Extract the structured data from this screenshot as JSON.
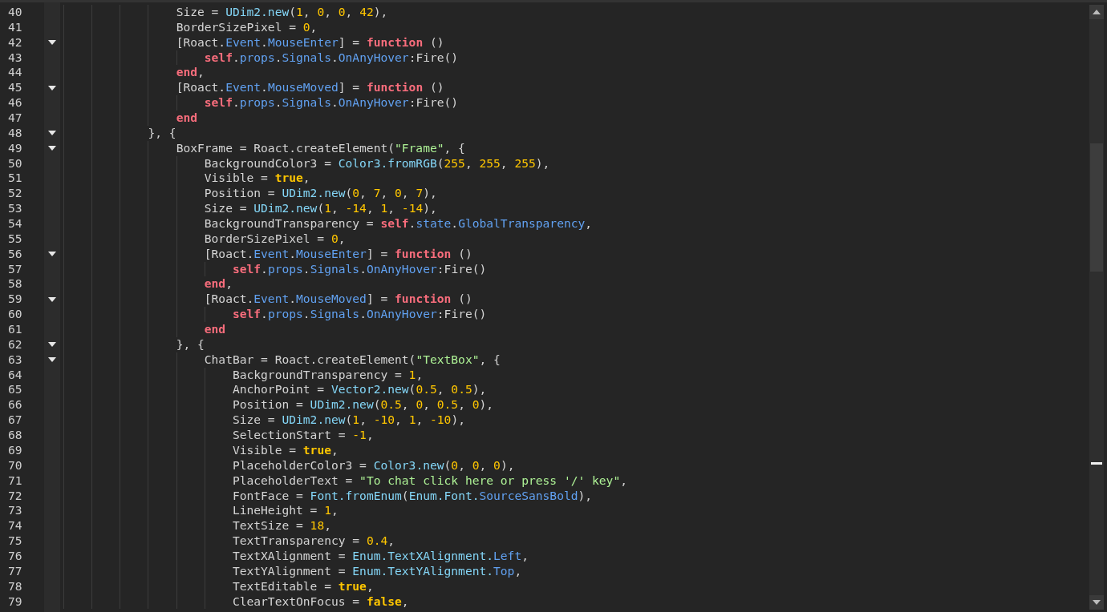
{
  "editor": {
    "lines": [
      {
        "number": "40",
        "fold": false,
        "tokens": [
          {
            "kind": "plain",
            "text": "                Size = "
          },
          {
            "kind": "builtin",
            "text": "UDim2.new"
          },
          {
            "kind": "plain",
            "text": "("
          },
          {
            "kind": "number",
            "text": "1"
          },
          {
            "kind": "plain",
            "text": ", "
          },
          {
            "kind": "number",
            "text": "0"
          },
          {
            "kind": "plain",
            "text": ", "
          },
          {
            "kind": "number",
            "text": "0"
          },
          {
            "kind": "plain",
            "text": ", "
          },
          {
            "kind": "number",
            "text": "42"
          },
          {
            "kind": "plain",
            "text": "),"
          }
        ]
      },
      {
        "number": "41",
        "fold": false,
        "tokens": [
          {
            "kind": "plain",
            "text": "                BorderSizePixel = "
          },
          {
            "kind": "number",
            "text": "0"
          },
          {
            "kind": "plain",
            "text": ","
          }
        ]
      },
      {
        "number": "42",
        "fold": true,
        "tokens": [
          {
            "kind": "plain",
            "text": "                [Roact."
          },
          {
            "kind": "member",
            "text": "Event"
          },
          {
            "kind": "plain",
            "text": "."
          },
          {
            "kind": "member",
            "text": "MouseEnter"
          },
          {
            "kind": "plain",
            "text": "] = "
          },
          {
            "kind": "keyword",
            "text": "function"
          },
          {
            "kind": "plain",
            "text": " ()"
          }
        ]
      },
      {
        "number": "43",
        "fold": false,
        "tokens": [
          {
            "kind": "keyword",
            "text": "                    self"
          },
          {
            "kind": "plain",
            "text": "."
          },
          {
            "kind": "member",
            "text": "props"
          },
          {
            "kind": "plain",
            "text": "."
          },
          {
            "kind": "member",
            "text": "Signals"
          },
          {
            "kind": "plain",
            "text": "."
          },
          {
            "kind": "member",
            "text": "OnAnyHover"
          },
          {
            "kind": "plain",
            "text": ":Fire()"
          }
        ]
      },
      {
        "number": "44",
        "fold": false,
        "tokens": [
          {
            "kind": "keyword",
            "text": "                end"
          },
          {
            "kind": "plain",
            "text": ","
          }
        ]
      },
      {
        "number": "45",
        "fold": true,
        "tokens": [
          {
            "kind": "plain",
            "text": "                [Roact."
          },
          {
            "kind": "member",
            "text": "Event"
          },
          {
            "kind": "plain",
            "text": "."
          },
          {
            "kind": "member",
            "text": "MouseMoved"
          },
          {
            "kind": "plain",
            "text": "] = "
          },
          {
            "kind": "keyword",
            "text": "function"
          },
          {
            "kind": "plain",
            "text": " ()"
          }
        ]
      },
      {
        "number": "46",
        "fold": false,
        "tokens": [
          {
            "kind": "keyword",
            "text": "                    self"
          },
          {
            "kind": "plain",
            "text": "."
          },
          {
            "kind": "member",
            "text": "props"
          },
          {
            "kind": "plain",
            "text": "."
          },
          {
            "kind": "member",
            "text": "Signals"
          },
          {
            "kind": "plain",
            "text": "."
          },
          {
            "kind": "member",
            "text": "OnAnyHover"
          },
          {
            "kind": "plain",
            "text": ":Fire()"
          }
        ]
      },
      {
        "number": "47",
        "fold": false,
        "tokens": [
          {
            "kind": "keyword",
            "text": "                end"
          }
        ]
      },
      {
        "number": "48",
        "fold": true,
        "tokens": [
          {
            "kind": "plain",
            "text": "            }, {"
          }
        ]
      },
      {
        "number": "49",
        "fold": true,
        "tokens": [
          {
            "kind": "plain",
            "text": "                BoxFrame = Roact.createElement("
          },
          {
            "kind": "string",
            "text": "\"Frame\""
          },
          {
            "kind": "plain",
            "text": ", {"
          }
        ]
      },
      {
        "number": "50",
        "fold": false,
        "tokens": [
          {
            "kind": "plain",
            "text": "                    BackgroundColor3 = "
          },
          {
            "kind": "builtin",
            "text": "Color3.fromRGB"
          },
          {
            "kind": "plain",
            "text": "("
          },
          {
            "kind": "number",
            "text": "255"
          },
          {
            "kind": "plain",
            "text": ", "
          },
          {
            "kind": "number",
            "text": "255"
          },
          {
            "kind": "plain",
            "text": ", "
          },
          {
            "kind": "number",
            "text": "255"
          },
          {
            "kind": "plain",
            "text": "),"
          }
        ]
      },
      {
        "number": "51",
        "fold": false,
        "tokens": [
          {
            "kind": "plain",
            "text": "                    Visible = "
          },
          {
            "kind": "boolean",
            "text": "true"
          },
          {
            "kind": "plain",
            "text": ","
          }
        ]
      },
      {
        "number": "52",
        "fold": false,
        "tokens": [
          {
            "kind": "plain",
            "text": "                    Position = "
          },
          {
            "kind": "builtin",
            "text": "UDim2.new"
          },
          {
            "kind": "plain",
            "text": "("
          },
          {
            "kind": "number",
            "text": "0"
          },
          {
            "kind": "plain",
            "text": ", "
          },
          {
            "kind": "number",
            "text": "7"
          },
          {
            "kind": "plain",
            "text": ", "
          },
          {
            "kind": "number",
            "text": "0"
          },
          {
            "kind": "plain",
            "text": ", "
          },
          {
            "kind": "number",
            "text": "7"
          },
          {
            "kind": "plain",
            "text": "),"
          }
        ]
      },
      {
        "number": "53",
        "fold": false,
        "tokens": [
          {
            "kind": "plain",
            "text": "                    Size = "
          },
          {
            "kind": "builtin",
            "text": "UDim2.new"
          },
          {
            "kind": "plain",
            "text": "("
          },
          {
            "kind": "number",
            "text": "1"
          },
          {
            "kind": "plain",
            "text": ", "
          },
          {
            "kind": "number",
            "text": "-14"
          },
          {
            "kind": "plain",
            "text": ", "
          },
          {
            "kind": "number",
            "text": "1"
          },
          {
            "kind": "plain",
            "text": ", "
          },
          {
            "kind": "number",
            "text": "-14"
          },
          {
            "kind": "plain",
            "text": "),"
          }
        ]
      },
      {
        "number": "54",
        "fold": false,
        "tokens": [
          {
            "kind": "plain",
            "text": "                    BackgroundTransparency = "
          },
          {
            "kind": "keyword",
            "text": "self"
          },
          {
            "kind": "plain",
            "text": "."
          },
          {
            "kind": "member",
            "text": "state"
          },
          {
            "kind": "plain",
            "text": "."
          },
          {
            "kind": "member",
            "text": "GlobalTransparency"
          },
          {
            "kind": "plain",
            "text": ","
          }
        ]
      },
      {
        "number": "55",
        "fold": false,
        "tokens": [
          {
            "kind": "plain",
            "text": "                    BorderSizePixel = "
          },
          {
            "kind": "number",
            "text": "0"
          },
          {
            "kind": "plain",
            "text": ","
          }
        ]
      },
      {
        "number": "56",
        "fold": true,
        "tokens": [
          {
            "kind": "plain",
            "text": "                    [Roact."
          },
          {
            "kind": "member",
            "text": "Event"
          },
          {
            "kind": "plain",
            "text": "."
          },
          {
            "kind": "member",
            "text": "MouseEnter"
          },
          {
            "kind": "plain",
            "text": "] = "
          },
          {
            "kind": "keyword",
            "text": "function"
          },
          {
            "kind": "plain",
            "text": " ()"
          }
        ]
      },
      {
        "number": "57",
        "fold": false,
        "tokens": [
          {
            "kind": "keyword",
            "text": "                        self"
          },
          {
            "kind": "plain",
            "text": "."
          },
          {
            "kind": "member",
            "text": "props"
          },
          {
            "kind": "plain",
            "text": "."
          },
          {
            "kind": "member",
            "text": "Signals"
          },
          {
            "kind": "plain",
            "text": "."
          },
          {
            "kind": "member",
            "text": "OnAnyHover"
          },
          {
            "kind": "plain",
            "text": ":Fire()"
          }
        ]
      },
      {
        "number": "58",
        "fold": false,
        "tokens": [
          {
            "kind": "keyword",
            "text": "                    end"
          },
          {
            "kind": "plain",
            "text": ","
          }
        ]
      },
      {
        "number": "59",
        "fold": true,
        "tokens": [
          {
            "kind": "plain",
            "text": "                    [Roact."
          },
          {
            "kind": "member",
            "text": "Event"
          },
          {
            "kind": "plain",
            "text": "."
          },
          {
            "kind": "member",
            "text": "MouseMoved"
          },
          {
            "kind": "plain",
            "text": "] = "
          },
          {
            "kind": "keyword",
            "text": "function"
          },
          {
            "kind": "plain",
            "text": " ()"
          }
        ]
      },
      {
        "number": "60",
        "fold": false,
        "tokens": [
          {
            "kind": "keyword",
            "text": "                        self"
          },
          {
            "kind": "plain",
            "text": "."
          },
          {
            "kind": "member",
            "text": "props"
          },
          {
            "kind": "plain",
            "text": "."
          },
          {
            "kind": "member",
            "text": "Signals"
          },
          {
            "kind": "plain",
            "text": "."
          },
          {
            "kind": "member",
            "text": "OnAnyHover"
          },
          {
            "kind": "plain",
            "text": ":Fire()"
          }
        ]
      },
      {
        "number": "61",
        "fold": false,
        "tokens": [
          {
            "kind": "keyword",
            "text": "                    end"
          }
        ]
      },
      {
        "number": "62",
        "fold": true,
        "tokens": [
          {
            "kind": "plain",
            "text": "                }, {"
          }
        ]
      },
      {
        "number": "63",
        "fold": true,
        "tokens": [
          {
            "kind": "plain",
            "text": "                    ChatBar = Roact.createElement("
          },
          {
            "kind": "string",
            "text": "\"TextBox\""
          },
          {
            "kind": "plain",
            "text": ", {"
          }
        ]
      },
      {
        "number": "64",
        "fold": false,
        "tokens": [
          {
            "kind": "plain",
            "text": "                        BackgroundTransparency = "
          },
          {
            "kind": "number",
            "text": "1"
          },
          {
            "kind": "plain",
            "text": ","
          }
        ]
      },
      {
        "number": "65",
        "fold": false,
        "tokens": [
          {
            "kind": "plain",
            "text": "                        AnchorPoint = "
          },
          {
            "kind": "builtin",
            "text": "Vector2.new"
          },
          {
            "kind": "plain",
            "text": "("
          },
          {
            "kind": "number",
            "text": "0.5"
          },
          {
            "kind": "plain",
            "text": ", "
          },
          {
            "kind": "number",
            "text": "0.5"
          },
          {
            "kind": "plain",
            "text": "),"
          }
        ]
      },
      {
        "number": "66",
        "fold": false,
        "tokens": [
          {
            "kind": "plain",
            "text": "                        Position = "
          },
          {
            "kind": "builtin",
            "text": "UDim2.new"
          },
          {
            "kind": "plain",
            "text": "("
          },
          {
            "kind": "number",
            "text": "0.5"
          },
          {
            "kind": "plain",
            "text": ", "
          },
          {
            "kind": "number",
            "text": "0"
          },
          {
            "kind": "plain",
            "text": ", "
          },
          {
            "kind": "number",
            "text": "0.5"
          },
          {
            "kind": "plain",
            "text": ", "
          },
          {
            "kind": "number",
            "text": "0"
          },
          {
            "kind": "plain",
            "text": "),"
          }
        ]
      },
      {
        "number": "67",
        "fold": false,
        "tokens": [
          {
            "kind": "plain",
            "text": "                        Size = "
          },
          {
            "kind": "builtin",
            "text": "UDim2.new"
          },
          {
            "kind": "plain",
            "text": "("
          },
          {
            "kind": "number",
            "text": "1"
          },
          {
            "kind": "plain",
            "text": ", "
          },
          {
            "kind": "number",
            "text": "-10"
          },
          {
            "kind": "plain",
            "text": ", "
          },
          {
            "kind": "number",
            "text": "1"
          },
          {
            "kind": "plain",
            "text": ", "
          },
          {
            "kind": "number",
            "text": "-10"
          },
          {
            "kind": "plain",
            "text": "),"
          }
        ]
      },
      {
        "number": "68",
        "fold": false,
        "tokens": [
          {
            "kind": "plain",
            "text": "                        SelectionStart = "
          },
          {
            "kind": "number",
            "text": "-1"
          },
          {
            "kind": "plain",
            "text": ","
          }
        ]
      },
      {
        "number": "69",
        "fold": false,
        "tokens": [
          {
            "kind": "plain",
            "text": "                        Visible = "
          },
          {
            "kind": "boolean",
            "text": "true"
          },
          {
            "kind": "plain",
            "text": ","
          }
        ]
      },
      {
        "number": "70",
        "fold": false,
        "tokens": [
          {
            "kind": "plain",
            "text": "                        PlaceholderColor3 = "
          },
          {
            "kind": "builtin",
            "text": "Color3.new"
          },
          {
            "kind": "plain",
            "text": "("
          },
          {
            "kind": "number",
            "text": "0"
          },
          {
            "kind": "plain",
            "text": ", "
          },
          {
            "kind": "number",
            "text": "0"
          },
          {
            "kind": "plain",
            "text": ", "
          },
          {
            "kind": "number",
            "text": "0"
          },
          {
            "kind": "plain",
            "text": "),"
          }
        ]
      },
      {
        "number": "71",
        "fold": false,
        "tokens": [
          {
            "kind": "plain",
            "text": "                        PlaceholderText = "
          },
          {
            "kind": "string",
            "text": "\"To chat click here or press '/' key\""
          },
          {
            "kind": "plain",
            "text": ","
          }
        ]
      },
      {
        "number": "72",
        "fold": false,
        "tokens": [
          {
            "kind": "plain",
            "text": "                        FontFace = "
          },
          {
            "kind": "builtin",
            "text": "Font.fromEnum"
          },
          {
            "kind": "plain",
            "text": "("
          },
          {
            "kind": "builtin",
            "text": "Enum.Font."
          },
          {
            "kind": "member",
            "text": "SourceSansBold"
          },
          {
            "kind": "plain",
            "text": "),"
          }
        ]
      },
      {
        "number": "73",
        "fold": false,
        "tokens": [
          {
            "kind": "plain",
            "text": "                        LineHeight = "
          },
          {
            "kind": "number",
            "text": "1"
          },
          {
            "kind": "plain",
            "text": ","
          }
        ]
      },
      {
        "number": "74",
        "fold": false,
        "tokens": [
          {
            "kind": "plain",
            "text": "                        TextSize = "
          },
          {
            "kind": "number",
            "text": "18"
          },
          {
            "kind": "plain",
            "text": ","
          }
        ]
      },
      {
        "number": "75",
        "fold": false,
        "tokens": [
          {
            "kind": "plain",
            "text": "                        TextTransparency = "
          },
          {
            "kind": "number",
            "text": "0.4"
          },
          {
            "kind": "plain",
            "text": ","
          }
        ]
      },
      {
        "number": "76",
        "fold": false,
        "tokens": [
          {
            "kind": "plain",
            "text": "                        TextXAlignment = "
          },
          {
            "kind": "builtin",
            "text": "Enum.TextXAlignment."
          },
          {
            "kind": "member",
            "text": "Left"
          },
          {
            "kind": "plain",
            "text": ","
          }
        ]
      },
      {
        "number": "77",
        "fold": false,
        "tokens": [
          {
            "kind": "plain",
            "text": "                        TextYAlignment = "
          },
          {
            "kind": "builtin",
            "text": "Enum.TextYAlignment."
          },
          {
            "kind": "member",
            "text": "Top"
          },
          {
            "kind": "plain",
            "text": ","
          }
        ]
      },
      {
        "number": "78",
        "fold": false,
        "tokens": [
          {
            "kind": "plain",
            "text": "                        TextEditable = "
          },
          {
            "kind": "boolean",
            "text": "true"
          },
          {
            "kind": "plain",
            "text": ","
          }
        ]
      },
      {
        "number": "79",
        "fold": false,
        "tokens": [
          {
            "kind": "plain",
            "text": "                        ClearTextOnFocus = "
          },
          {
            "kind": "boolean",
            "text": "false"
          },
          {
            "kind": "plain",
            "text": ","
          }
        ]
      }
    ]
  }
}
